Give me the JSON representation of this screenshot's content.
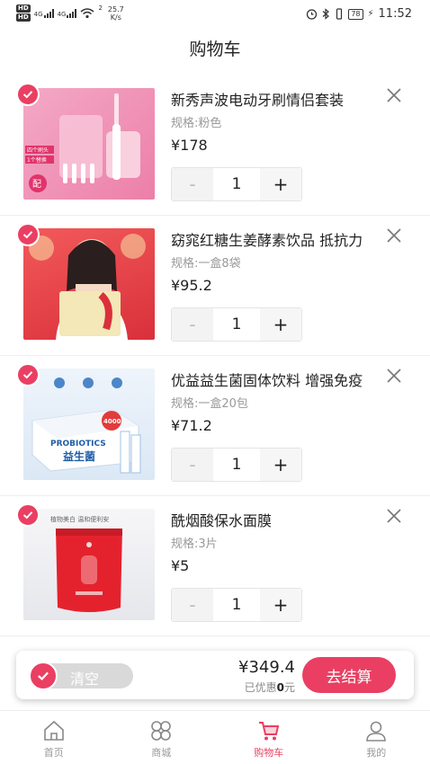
{
  "status_bar": {
    "network_a": "4G",
    "network_b": "4G",
    "wifi_level": "2",
    "speed_value": "25.7",
    "speed_unit": "K/s",
    "battery": "78",
    "time": "11:52",
    "hd_label": "HD"
  },
  "page": {
    "title": "购物车"
  },
  "cart": {
    "items": [
      {
        "name": "新秀声波电动牙刷情侣套装",
        "spec": "规格:粉色",
        "price": "¥178",
        "quantity": "1",
        "checked": true
      },
      {
        "name": "窈窕红糖生姜酵素饮品 抵抗力",
        "spec": "规格:一盒8袋",
        "price": "¥95.2",
        "quantity": "1",
        "checked": true
      },
      {
        "name": "优益益生菌固体饮料 增强免疫",
        "spec": "规格:一盒20包",
        "price": "¥71.2",
        "quantity": "1",
        "checked": true
      },
      {
        "name": "酰烟酸保水面膜",
        "spec": "规格:3片",
        "price": "¥5",
        "quantity": "1",
        "checked": true
      }
    ],
    "minus_label": "-",
    "plus_label": "+"
  },
  "thumbnails": {
    "item1_tag_a": "四个刷头",
    "item1_tag_b": "1个替换",
    "item1_badge": "配",
    "item3_brand": "PROBIOTICS",
    "item3_cn": "益生菌",
    "item3_badge": "4000",
    "item4_caption": "植物美白 温和便利安"
  },
  "checkout": {
    "clear_label": "清空",
    "total": "¥349.4",
    "discount_prefix": "已优惠",
    "discount_value": "0",
    "discount_suffix": "元",
    "button_label": "去结算"
  },
  "tabs": [
    {
      "label": "首页",
      "icon": "home-icon"
    },
    {
      "label": "商城",
      "icon": "mall-icon"
    },
    {
      "label": "购物车",
      "icon": "cart-icon",
      "active": true
    },
    {
      "label": "我的",
      "icon": "profile-icon"
    }
  ],
  "colors": {
    "accent": "#ea3f62",
    "muted": "#999999"
  }
}
